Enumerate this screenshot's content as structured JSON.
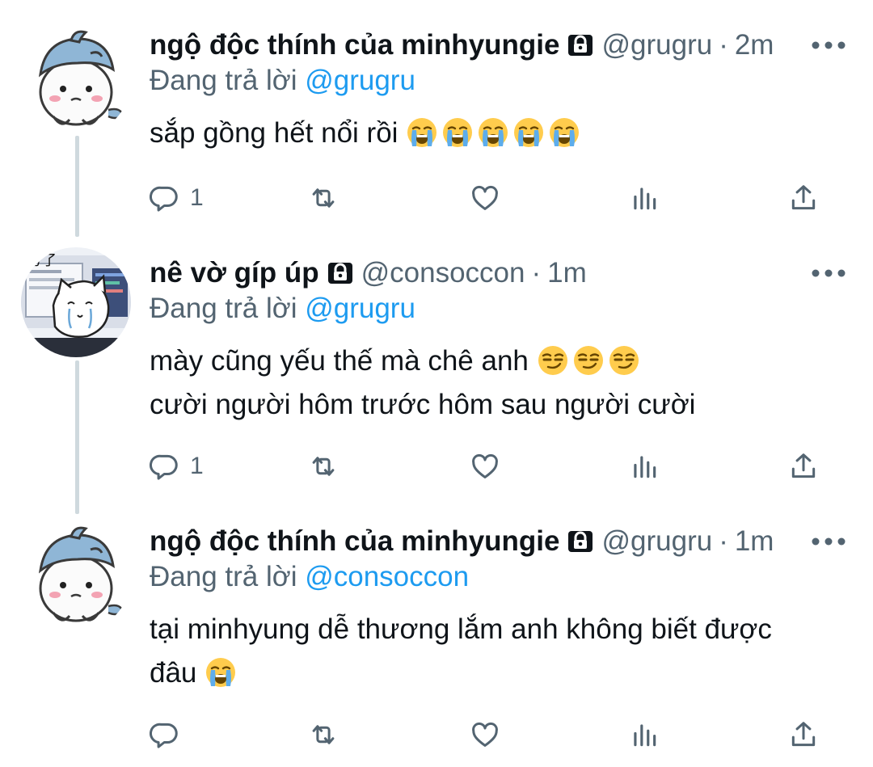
{
  "colors": {
    "text_primary": "#0f1419",
    "text_secondary": "#536471",
    "link": "#1d9bf0",
    "thread_line": "#cfd9de"
  },
  "tweets": [
    {
      "display_name": "ngộ độc thính của minhyungie",
      "handle": "@grugru",
      "separator": "·",
      "time": "2m",
      "reply_prefix": "Đang trả lời",
      "reply_to": "@grugru",
      "lines": [
        "sắp gồng hết nổi rồi"
      ],
      "emoji": "loudly-crying-face",
      "emoji_count": 5,
      "reply_count": "1",
      "avatar": "white-creature-blue-hat"
    },
    {
      "display_name": "nê vờ gíp úp",
      "handle": "@consoccon",
      "separator": "·",
      "time": "1m",
      "reply_prefix": "Đang trả lời",
      "reply_to": "@grugru",
      "lines": [
        "mày cũng yếu thế mà chê anh",
        "cười người hôm trước hôm sau người cười"
      ],
      "emoji": "smirking-face",
      "emoji_count": 3,
      "reply_count": "1",
      "avatar": "crying-cat-at-computer"
    },
    {
      "display_name": "ngộ độc thính của minhyungie",
      "handle": "@grugru",
      "separator": "·",
      "time": "1m",
      "reply_prefix": "Đang trả lời",
      "reply_to": "@consoccon",
      "lines": [
        "tại minhyung dễ thương lắm anh không biết được",
        "đâu"
      ],
      "emoji": "loudly-crying-face",
      "emoji_count": 1,
      "reply_count": "",
      "avatar": "white-creature-blue-hat"
    }
  ],
  "icons": {
    "lock": "lock-icon",
    "more": "more-options-icon",
    "reply": "reply-icon",
    "retweet": "retweet-icon",
    "like": "like-icon",
    "views": "views-icon",
    "share": "share-icon"
  }
}
